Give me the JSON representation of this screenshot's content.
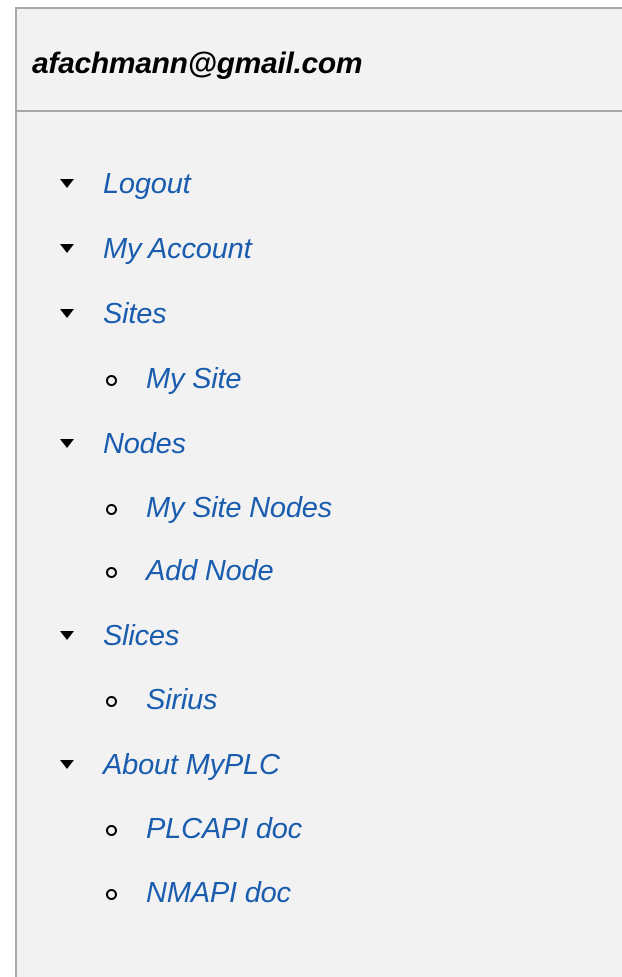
{
  "header": {
    "email": "afachmann@gmail.com"
  },
  "menu": {
    "logout": "Logout",
    "my_account": "My Account",
    "sites": {
      "label": "Sites",
      "items": [
        "My Site"
      ]
    },
    "nodes": {
      "label": "Nodes",
      "items": [
        "My Site Nodes",
        "Add Node"
      ]
    },
    "slices": {
      "label": "Slices",
      "items": [
        "Sirius"
      ]
    },
    "about": {
      "label": "About MyPLC",
      "items": [
        "PLCAPI doc",
        "NMAPI doc"
      ]
    }
  },
  "colors": {
    "link": "#1a5cae",
    "panel_bg": "#f2f2f2",
    "border": "#a8a8a8"
  }
}
